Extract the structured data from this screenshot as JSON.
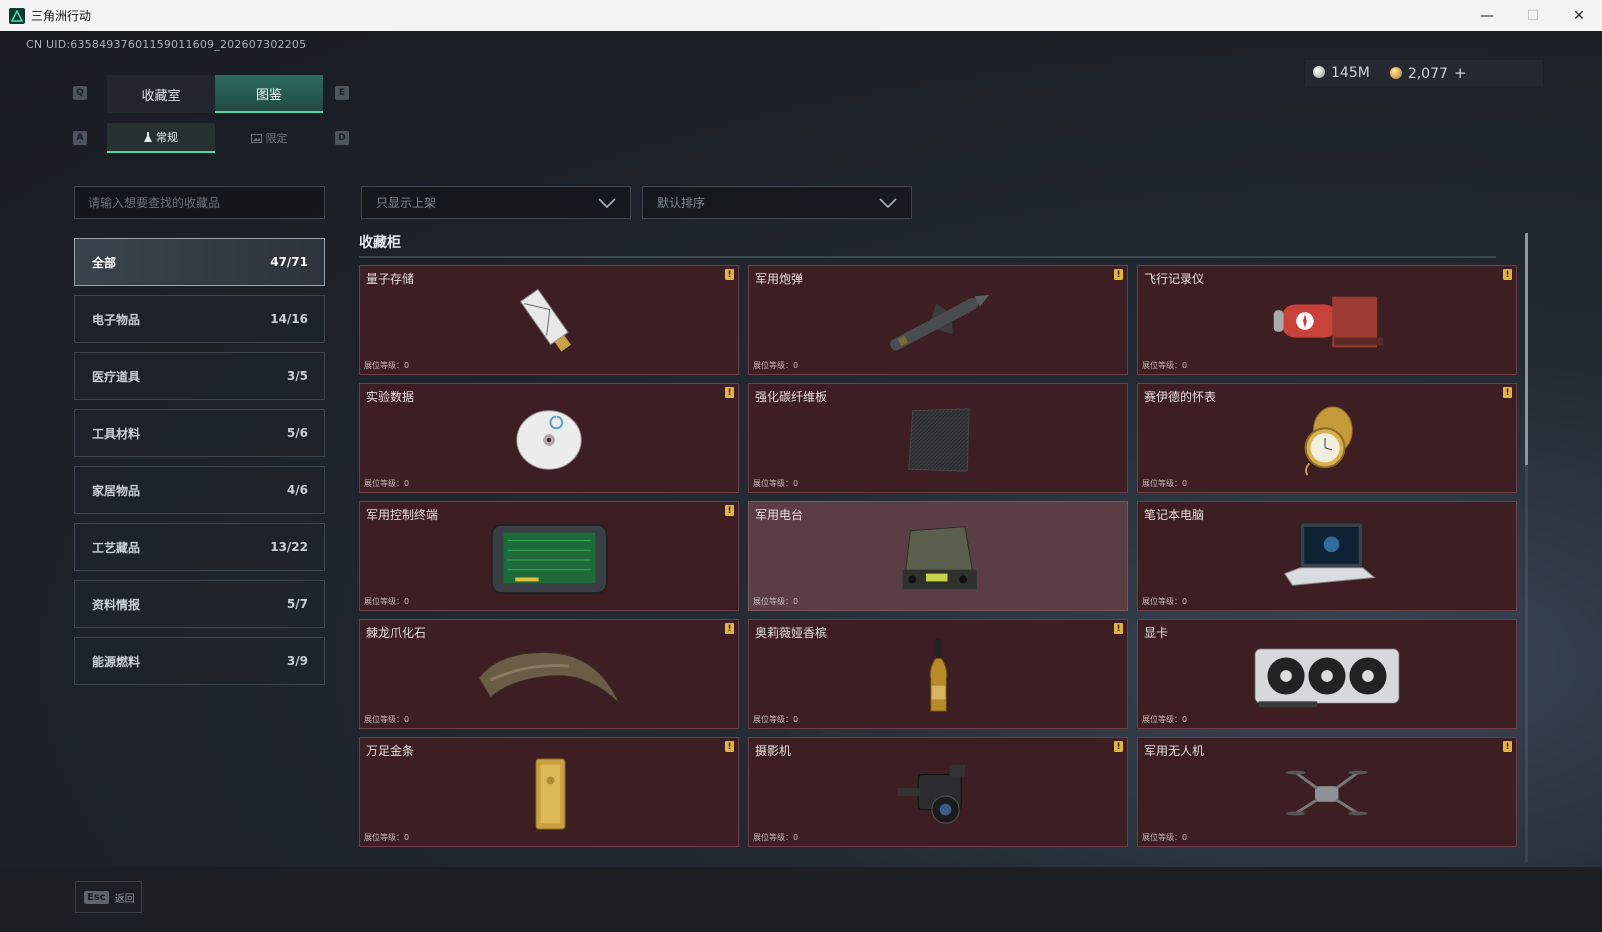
{
  "window": {
    "title": "三角洲行动",
    "minimize": "—",
    "maximize": "☐",
    "close": "✕"
  },
  "uid": "CN UID:635849376011590116​09_202607302205",
  "currency": {
    "silver": "145M",
    "gold": "2,077",
    "plus": "+"
  },
  "keyhints": {
    "q": "Q",
    "e": "E",
    "a": "A",
    "d": "D"
  },
  "main_tabs": [
    "收藏室",
    "图鉴"
  ],
  "sub_tabs": [
    "常规",
    "限定"
  ],
  "search": {
    "placeholder": "请输入想要查找的收藏品"
  },
  "filters": {
    "shelf": "只显示上架",
    "sort": "默认排序"
  },
  "categories": [
    {
      "label": "全部",
      "count": "47/71"
    },
    {
      "label": "电子物品",
      "count": "14/16"
    },
    {
      "label": "医疗道具",
      "count": "3/5"
    },
    {
      "label": "工具材料",
      "count": "5/6"
    },
    {
      "label": "家居物品",
      "count": "4/6"
    },
    {
      "label": "工艺藏品",
      "count": "13/22"
    },
    {
      "label": "资料情报",
      "count": "5/7"
    },
    {
      "label": "能源燃料",
      "count": "3/9"
    }
  ],
  "section_title": "收藏柜",
  "items": [
    {
      "name": "量子存储",
      "level": "展位等级：0",
      "badge": "!"
    },
    {
      "name": "军用炮弹",
      "level": "展位等级：0",
      "badge": "!"
    },
    {
      "name": "飞行记录仪",
      "level": "展位等级：0",
      "badge": "!"
    },
    {
      "name": "实验数据",
      "level": "展位等级：0",
      "badge": "!"
    },
    {
      "name": "强化碳纤维板",
      "level": "展位等级：0",
      "badge": ""
    },
    {
      "name": "赛伊德的怀表",
      "level": "展位等级：0",
      "badge": "!"
    },
    {
      "name": "军用控制终端",
      "level": "展位等级：0",
      "badge": "!"
    },
    {
      "name": "军用电台",
      "level": "展位等级：0",
      "badge": ""
    },
    {
      "name": "笔记本电脑",
      "level": "展位等级：0",
      "badge": ""
    },
    {
      "name": "棘龙爪化石",
      "level": "展位等级：0",
      "badge": "!"
    },
    {
      "name": "奥莉薇娅香槟",
      "level": "展位等级：0",
      "badge": "!"
    },
    {
      "name": "显卡",
      "level": "展位等级：0",
      "badge": ""
    },
    {
      "name": "万足金条",
      "level": "展位等级：0",
      "badge": "!"
    },
    {
      "name": "摄影机",
      "level": "展位等级：0",
      "badge": "!"
    },
    {
      "name": "军用无人机",
      "level": "展位等级：0",
      "badge": "!"
    }
  ],
  "bottom": {
    "esc_key": "Esc",
    "esc_label": "返回"
  }
}
